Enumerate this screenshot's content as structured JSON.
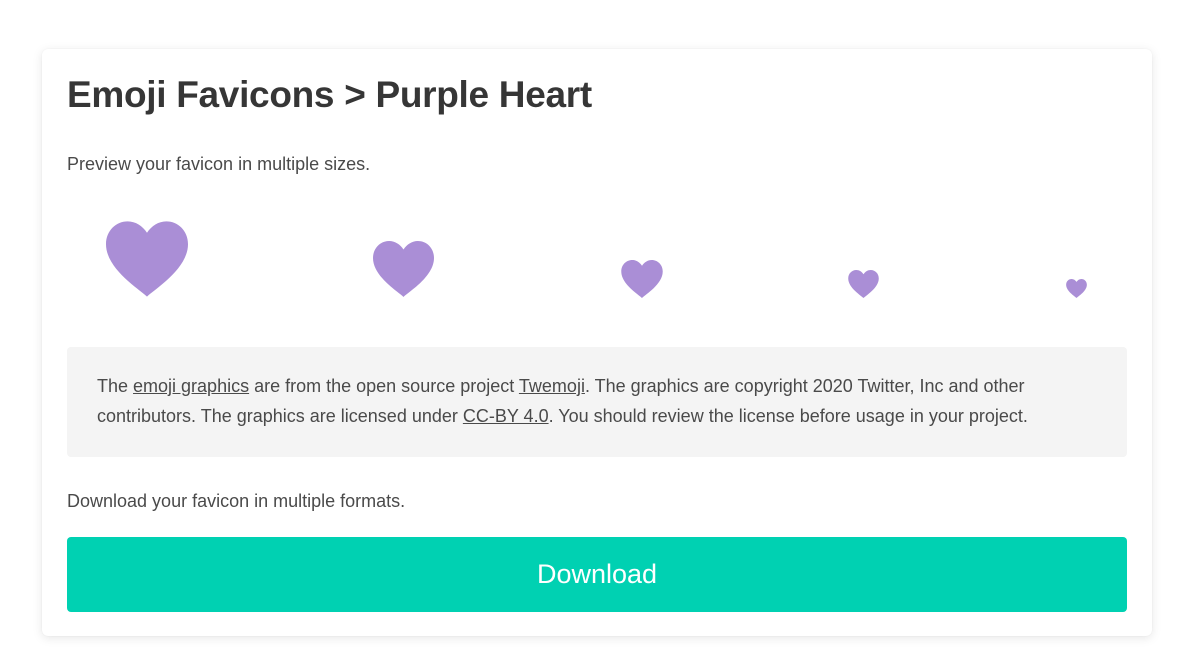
{
  "page": {
    "title": "Emoji Favicons > Purple Heart",
    "preview_text": "Preview your favicon in multiple sizes.",
    "download_text": "Download your favicon in multiple formats.",
    "download_button": "Download"
  },
  "hearts": {
    "icon": "purple-heart-icon",
    "color": "#aa8ed6",
    "count": 5
  },
  "notice": {
    "part1": "The ",
    "link_emoji_graphics": "emoji graphics",
    "part2": " are from the open source project ",
    "link_twemoji": "Twemoji",
    "part3": ". The graphics are copyright 2020 Twitter, Inc and other contributors. The graphics are licensed under ",
    "link_license": "CC-BY 4.0",
    "part4": ". You should review the license before usage in your project."
  },
  "colors": {
    "accent": "#00d1b2",
    "notice_bg": "#f4f4f4",
    "text": "#4a4a4a"
  }
}
